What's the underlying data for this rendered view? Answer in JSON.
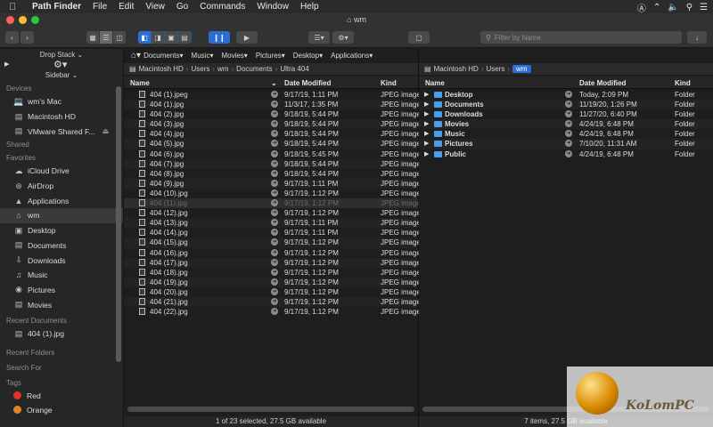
{
  "menubar": {
    "apple_icon": "apple-icon",
    "app_name": "Path Finder",
    "items": [
      "File",
      "Edit",
      "View",
      "Go",
      "Commands",
      "Window",
      "Help"
    ]
  },
  "window": {
    "title": "wm"
  },
  "toolbar": {
    "search_placeholder": "Filter by Name"
  },
  "sidebar": {
    "drop_stack_label": "Drop Stack",
    "sidebar_label": "Sidebar",
    "devices_header": "Devices",
    "devices": [
      "wm's Mac",
      "Macintosh HD",
      "VMware Shared F..."
    ],
    "shared_header": "Shared",
    "favorites_header": "Favorites",
    "favorites": [
      "iCloud Drive",
      "AirDrop",
      "Applications",
      "wm",
      "Desktop",
      "Documents",
      "Downloads",
      "Music",
      "Pictures",
      "Movies"
    ],
    "recent_docs_header": "Recent Documents",
    "recent_docs": [
      "404 (1).jpg"
    ],
    "recent_folders_header": "Recent Folders",
    "search_for_header": "Search For",
    "tags_header": "Tags",
    "tags": [
      {
        "label": "Red",
        "color": "#e0352b"
      },
      {
        "label": "Orange",
        "color": "#e0861e"
      }
    ]
  },
  "left_pane": {
    "crumbs": [
      "Documents",
      "Music",
      "Movies",
      "Pictures",
      "Desktop",
      "Applications"
    ],
    "path": [
      "Macintosh HD",
      "Users",
      "wm",
      "Documents",
      "Ultra 404"
    ],
    "columns": {
      "name": "Name",
      "date": "Date Modified",
      "kind": "Kind"
    },
    "rows": [
      {
        "name": "404 (1).jpeg",
        "date": "9/17/19, 1:11 PM",
        "kind": "JPEG image"
      },
      {
        "name": "404 (1).jpg",
        "date": "11/3/17, 1:35 PM",
        "kind": "JPEG image"
      },
      {
        "name": "404 (2).jpg",
        "date": "9/18/19, 5:44 PM",
        "kind": "JPEG image"
      },
      {
        "name": "404 (3).jpg",
        "date": "9/18/19, 5:44 PM",
        "kind": "JPEG image"
      },
      {
        "name": "404 (4).jpg",
        "date": "9/18/19, 5:44 PM",
        "kind": "JPEG image"
      },
      {
        "name": "404 (5).jpg",
        "date": "9/18/19, 5:44 PM",
        "kind": "JPEG image"
      },
      {
        "name": "404 (6).jpg",
        "date": "9/18/19, 5:45 PM",
        "kind": "JPEG image"
      },
      {
        "name": "404 (7).jpg",
        "date": "9/18/19, 5:44 PM",
        "kind": "JPEG image"
      },
      {
        "name": "404 (8).jpg",
        "date": "9/18/19, 5:44 PM",
        "kind": "JPEG image"
      },
      {
        "name": "404 (9).jpg",
        "date": "9/17/19, 1:11 PM",
        "kind": "JPEG image"
      },
      {
        "name": "404 (10).jpg",
        "date": "9/17/19, 1:12 PM",
        "kind": "JPEG image"
      },
      {
        "name": "404 (11).jpg",
        "date": "9/17/19, 1:12 PM",
        "kind": "JPEG image",
        "dim": true
      },
      {
        "name": "404 (12).jpg",
        "date": "9/17/19, 1:12 PM",
        "kind": "JPEG image"
      },
      {
        "name": "404 (13).jpg",
        "date": "9/17/19, 1:11 PM",
        "kind": "JPEG image"
      },
      {
        "name": "404 (14).jpg",
        "date": "9/17/19, 1:11 PM",
        "kind": "JPEG image"
      },
      {
        "name": "404 (15).jpg",
        "date": "9/17/19, 1:12 PM",
        "kind": "JPEG image"
      },
      {
        "name": "404 (16).jpg",
        "date": "9/17/19, 1:12 PM",
        "kind": "JPEG image"
      },
      {
        "name": "404 (17).jpg",
        "date": "9/17/19, 1:12 PM",
        "kind": "JPEG image"
      },
      {
        "name": "404 (18).jpg",
        "date": "9/17/19, 1:12 PM",
        "kind": "JPEG image"
      },
      {
        "name": "404 (19).jpg",
        "date": "9/17/19, 1:12 PM",
        "kind": "JPEG image"
      },
      {
        "name": "404 (20).jpg",
        "date": "9/17/19, 1:12 PM",
        "kind": "JPEG image"
      },
      {
        "name": "404 (21).jpg",
        "date": "9/17/19, 1:12 PM",
        "kind": "JPEG image"
      },
      {
        "name": "404 (22).jpg",
        "date": "9/17/19, 1:12 PM",
        "kind": "JPEG image"
      }
    ],
    "status": "1 of 23 selected, 27.5 GB available"
  },
  "right_pane": {
    "path": [
      "Macintosh HD",
      "Users",
      "wm"
    ],
    "columns": {
      "name": "Name",
      "date": "Date Modified",
      "kind": "Kind"
    },
    "rows": [
      {
        "name": "Desktop",
        "date": "Today, 2:09 PM",
        "kind": "Folder"
      },
      {
        "name": "Documents",
        "date": "11/19/20, 1:26 PM",
        "kind": "Folder"
      },
      {
        "name": "Downloads",
        "date": "11/27/20, 6:40 PM",
        "kind": "Folder"
      },
      {
        "name": "Movies",
        "date": "4/24/19, 6:48 PM",
        "kind": "Folder"
      },
      {
        "name": "Music",
        "date": "4/24/19, 6:48 PM",
        "kind": "Folder"
      },
      {
        "name": "Pictures",
        "date": "7/10/20, 11:31 AM",
        "kind": "Folder"
      },
      {
        "name": "Public",
        "date": "4/24/19, 6:48 PM",
        "kind": "Folder"
      }
    ],
    "status": "7 items, 27.5 GB available"
  },
  "watermark": {
    "text": "KoLomPC"
  }
}
